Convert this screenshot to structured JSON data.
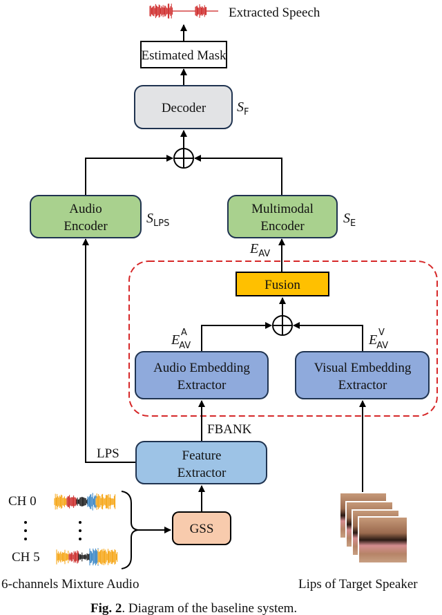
{
  "output": {
    "label": "Extracted Speech"
  },
  "blocks": {
    "estimated_mask": "Estimated Mask",
    "decoder": {
      "line1": "Decoder",
      "symbol": "S",
      "subscript": "F"
    },
    "audio_encoder": {
      "line1": "Audio",
      "line2": "Encoder",
      "symbol": "S",
      "subscript": "LPS"
    },
    "multimodal_encoder": {
      "line1": "Multimodal",
      "line2": "Encoder",
      "symbol": "S",
      "subscript": "E"
    },
    "fusion": "Fusion",
    "audio_embedding_extractor": {
      "line1": "Audio Embedding",
      "line2": "Extractor"
    },
    "visual_embedding_extractor": {
      "line1": "Visual Embedding",
      "line2": "Extractor"
    },
    "feature_extractor": {
      "line1": "Feature",
      "line2": "Extractor"
    },
    "gss": "GSS"
  },
  "signals": {
    "e_av": {
      "symbol": "E",
      "subscript": "AV"
    },
    "e_av_a": {
      "symbol": "E",
      "subscript": "AV",
      "superscript": "A"
    },
    "e_av_v": {
      "symbol": "E",
      "subscript": "AV",
      "superscript": "V"
    },
    "fbank": "FBANK",
    "lps": "LPS"
  },
  "inputs": {
    "channels": [
      "CH 0",
      "CH 5"
    ],
    "ellipsis": "⋮",
    "mixture_label": "6-channels Mixture Audio",
    "lips_label": "Lips of Target Speaker"
  },
  "caption": {
    "prefix": "Fig. 2",
    "text": ". Diagram of the baseline system."
  },
  "colors": {
    "decoder_fill": "#e2e3e5",
    "encoder_fill": "#a9d18e",
    "fusion_fill": "#ffc000",
    "extractor_fill": "#8faadc",
    "feature_fill": "#9dc3e6",
    "gss_fill": "#f8cbad",
    "box_stroke": "#1f3350",
    "dashed_region": "#d62728",
    "speech_wave": "#cc1f1f",
    "wave_orange": "#f5a10a",
    "wave_red": "#c8201e",
    "wave_black": "#111111",
    "wave_blue": "#2f7fc1"
  }
}
